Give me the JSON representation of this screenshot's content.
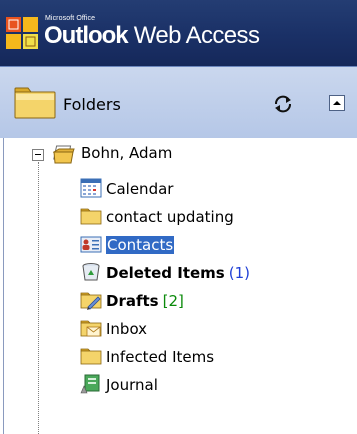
{
  "header": {
    "brand_small": "Microsoft Office",
    "brand_outlook": "Outlook",
    "brand_rest": "Web Access",
    "background": "#1a3066"
  },
  "folder_bar": {
    "label": "Folders",
    "refresh_icon": "refresh-icon",
    "collapse_icon": "chevron-up-icon"
  },
  "tree": {
    "root_label": "Bohn, Adam",
    "selected_color": "#316ac5",
    "items": [
      {
        "label": "Calendar",
        "icon": "calendar-icon",
        "bold": false,
        "count": ""
      },
      {
        "label": "contact updating",
        "icon": "folder-icon",
        "bold": false,
        "count": ""
      },
      {
        "label": "Contacts",
        "icon": "contacts-icon",
        "bold": false,
        "count": "",
        "selected": true
      },
      {
        "label": "Deleted Items",
        "icon": "deleted-items-icon",
        "bold": true,
        "count": "(1)"
      },
      {
        "label": "Drafts",
        "icon": "drafts-icon",
        "bold": true,
        "count": "[2]"
      },
      {
        "label": "Inbox",
        "icon": "inbox-icon",
        "bold": false,
        "count": ""
      },
      {
        "label": "Infected Items",
        "icon": "folder-icon",
        "bold": false,
        "count": ""
      },
      {
        "label": "Journal",
        "icon": "journal-icon",
        "bold": false,
        "count": ""
      }
    ]
  }
}
